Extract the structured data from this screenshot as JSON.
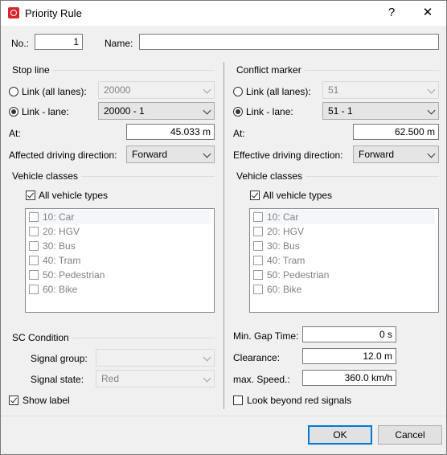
{
  "window": {
    "title": "Priority Rule",
    "help": "?",
    "close": "✕"
  },
  "header": {
    "no_label": "No.:",
    "no_value": "1",
    "name_label": "Name:",
    "name_value": ""
  },
  "stop_line": {
    "title": "Stop line",
    "link_all_label": "Link (all lanes):",
    "link_all_value": "20000",
    "link_lane_label": "Link - lane:",
    "link_lane_value": "20000 - 1",
    "at_label": "At:",
    "at_value": "45.033 m",
    "direction_label": "Affected driving direction:",
    "direction_value": "Forward",
    "vehicle_classes_title": "Vehicle classes",
    "all_vehicle_types_label": "All vehicle types",
    "vehicle_classes": [
      "10: Car",
      "20: HGV",
      "30: Bus",
      "40: Tram",
      "50: Pedestrian",
      "60: Bike"
    ]
  },
  "conflict_marker": {
    "title": "Conflict marker",
    "link_all_label": "Link (all lanes):",
    "link_all_value": "51",
    "link_lane_label": "Link - lane:",
    "link_lane_value": "51 - 1",
    "at_label": "At:",
    "at_value": "62.500 m",
    "direction_label": "Effective driving direction:",
    "direction_value": "Forward",
    "vehicle_classes_title": "Vehicle classes",
    "all_vehicle_types_label": "All vehicle types",
    "vehicle_classes": [
      "10: Car",
      "20: HGV",
      "30: Bus",
      "40: Tram",
      "50: Pedestrian",
      "60: Bike"
    ]
  },
  "sc_condition": {
    "title": "SC Condition",
    "signal_group_label": "Signal group:",
    "signal_group_value": "",
    "signal_state_label": "Signal state:",
    "signal_state_value": "Red",
    "show_label": "Show label"
  },
  "gap": {
    "min_gap_label": "Min. Gap Time:",
    "min_gap_value": "0 s",
    "clearance_label": "Clearance:",
    "clearance_value": "12.0 m",
    "max_speed_label": "max. Speed.:",
    "max_speed_value": "360.0 km/h",
    "look_beyond_label": "Look beyond red signals"
  },
  "footer": {
    "ok_label": "OK",
    "cancel_label": "Cancel"
  }
}
